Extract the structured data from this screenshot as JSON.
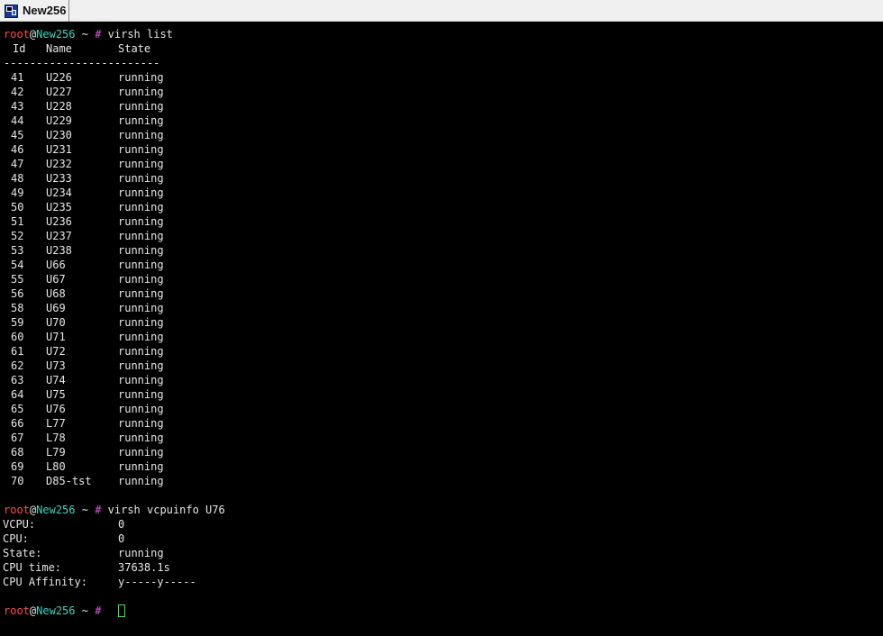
{
  "tab": {
    "title": "New256",
    "icon": "putty-terminal-icon"
  },
  "prompt": {
    "user": "root",
    "at": "@",
    "host": "New256",
    "path": " ~ ",
    "symbol": "#"
  },
  "colors": {
    "background": "#000000",
    "foreground": "#e6e6e6",
    "user": "#ff4d4d",
    "host": "#37d6c2",
    "hash": "#d85bd8",
    "cursor": "#3ee83e"
  },
  "commands": {
    "first": "virsh list",
    "second": "virsh vcpuinfo U76"
  },
  "list": {
    "header": {
      "id": "Id",
      "name": "Name",
      "state": "State"
    },
    "separator": "------------------------",
    "rows": [
      {
        "id": "41",
        "name": "U226",
        "state": "running"
      },
      {
        "id": "42",
        "name": "U227",
        "state": "running"
      },
      {
        "id": "43",
        "name": "U228",
        "state": "running"
      },
      {
        "id": "44",
        "name": "U229",
        "state": "running"
      },
      {
        "id": "45",
        "name": "U230",
        "state": "running"
      },
      {
        "id": "46",
        "name": "U231",
        "state": "running"
      },
      {
        "id": "47",
        "name": "U232",
        "state": "running"
      },
      {
        "id": "48",
        "name": "U233",
        "state": "running"
      },
      {
        "id": "49",
        "name": "U234",
        "state": "running"
      },
      {
        "id": "50",
        "name": "U235",
        "state": "running"
      },
      {
        "id": "51",
        "name": "U236",
        "state": "running"
      },
      {
        "id": "52",
        "name": "U237",
        "state": "running"
      },
      {
        "id": "53",
        "name": "U238",
        "state": "running"
      },
      {
        "id": "54",
        "name": "U66",
        "state": "running"
      },
      {
        "id": "55",
        "name": "U67",
        "state": "running"
      },
      {
        "id": "56",
        "name": "U68",
        "state": "running"
      },
      {
        "id": "58",
        "name": "U69",
        "state": "running"
      },
      {
        "id": "59",
        "name": "U70",
        "state": "running"
      },
      {
        "id": "60",
        "name": "U71",
        "state": "running"
      },
      {
        "id": "61",
        "name": "U72",
        "state": "running"
      },
      {
        "id": "62",
        "name": "U73",
        "state": "running"
      },
      {
        "id": "63",
        "name": "U74",
        "state": "running"
      },
      {
        "id": "64",
        "name": "U75",
        "state": "running"
      },
      {
        "id": "65",
        "name": "U76",
        "state": "running"
      },
      {
        "id": "66",
        "name": "L77",
        "state": "running"
      },
      {
        "id": "67",
        "name": "L78",
        "state": "running"
      },
      {
        "id": "68",
        "name": "L79",
        "state": "running"
      },
      {
        "id": "69",
        "name": "L80",
        "state": "running"
      },
      {
        "id": "70",
        "name": "D85-tst",
        "state": "running"
      }
    ]
  },
  "vcpuinfo": [
    {
      "key": "VCPU:",
      "value": "0"
    },
    {
      "key": "CPU:",
      "value": "0"
    },
    {
      "key": "State:",
      "value": "running"
    },
    {
      "key": "CPU time:",
      "value": "37638.1s"
    },
    {
      "key": "CPU Affinity:",
      "value": "y-----y-----"
    }
  ]
}
